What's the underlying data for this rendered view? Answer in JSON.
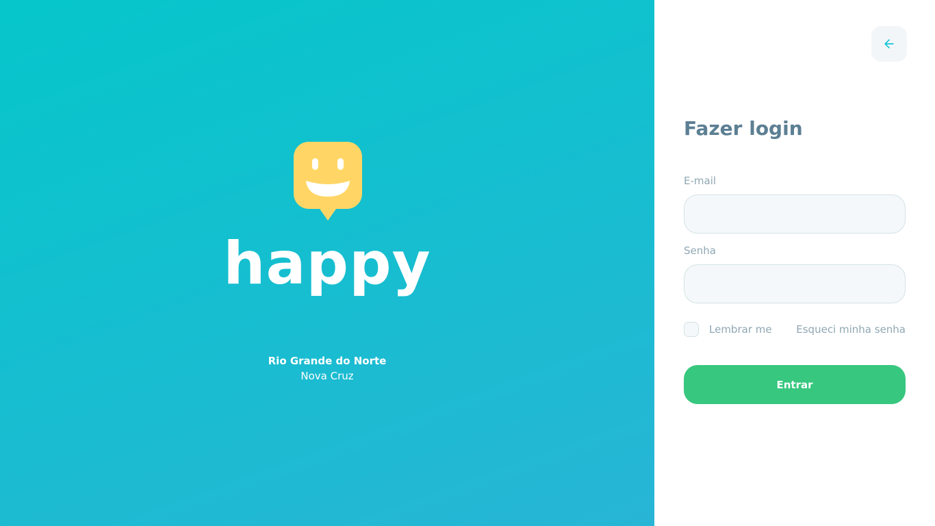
{
  "hero": {
    "brand": "happy",
    "location": {
      "state": "Rio Grande do Norte",
      "city": "Nova Cruz"
    },
    "logo_icon": "smiley-speech-bubble-icon"
  },
  "login": {
    "back_icon": "arrow-left-icon",
    "title": "Fazer login",
    "email_label": "E-mail",
    "email_value": "",
    "password_label": "Senha",
    "password_value": "",
    "remember_label": "Lembrar me",
    "remember_checked": false,
    "forgot_label": "Esqueci minha senha",
    "submit_label": "Entrar"
  },
  "colors": {
    "hero_gradient_start": "#06c6cb",
    "hero_gradient_end": "#28b5d6",
    "logo_yellow": "#ffd666",
    "title_text": "#5c7f93",
    "muted_text": "#8fa7b3",
    "input_bg": "#f5f8fa",
    "input_border": "#d3e2e5",
    "submit_green": "#37c77f",
    "back_arrow": "#15c3d6"
  }
}
